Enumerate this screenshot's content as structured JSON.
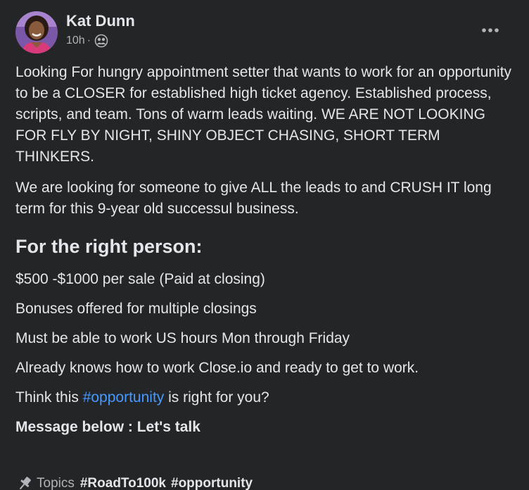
{
  "author": {
    "name": "Kat Dunn",
    "time": "10h",
    "separator": "·",
    "audience_icon": "friends-icon"
  },
  "menu": {
    "icon": "more-options-icon",
    "label": "•••"
  },
  "post": {
    "paragraph1": "Looking For hungry appointment setter that wants to work for an opportunity to be a CLOSER for established high ticket agency. Established process, scripts, and team. Tons of warm leads waiting. WE ARE NOT LOOKING FOR FLY BY NIGHT, SHINY OBJECT CHASING, SHORT TERM THINKERS.",
    "paragraph2": "We are looking for someone to give ALL the leads to and CRUSH IT long term for this 9-year old successul business.",
    "heading": "For the right person:",
    "lines": [
      "$500 -$1000 per sale (Paid at closing)",
      "Bonuses offered for multiple closings",
      "Must be able to work US hours Mon through Friday",
      "Already knows how to work Close.io and ready to get to work."
    ],
    "question_before": "Think this ",
    "question_hashtag": "#opportunity",
    "question_after": " is right for you?",
    "cta": "Message below : Let's talk"
  },
  "topics": {
    "label": "Topics",
    "icon": "pin-icon",
    "tags": [
      "#RoadTo100k",
      "#opportunity"
    ]
  },
  "colors": {
    "background": "#242526",
    "text": "#e4e6eb",
    "secondary": "#b0b3b8",
    "link": "#4599ff"
  }
}
